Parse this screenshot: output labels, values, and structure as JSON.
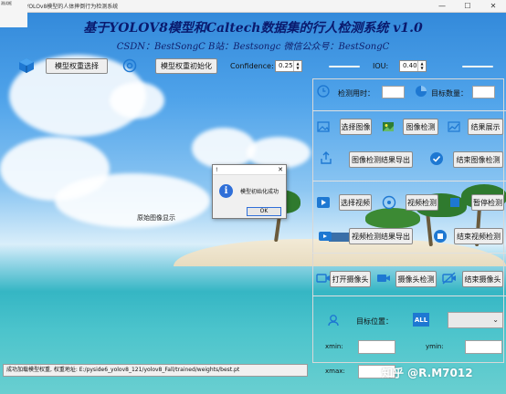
{
  "window": {
    "title": "基于YOLOv8模型的人体摔倒行为检测系统",
    "min_glyph": "—",
    "max_glyph": "☐",
    "close_glyph": "✕",
    "corner_note": "测试框"
  },
  "header": {
    "title": "基于YOLOV8模型和Caltech数据集的行人检测系统 v1.0",
    "subtitle": "CSDN：BestSongC   B站：Bestsongc   微信公众号：BestSongC"
  },
  "toolbar": {
    "select_weights_label": "模型权重选择",
    "init_weights_label": "模型权重初始化",
    "confidence_label": "Confidence:",
    "confidence_value": "0.25",
    "iou_label": "IOU:",
    "iou_value": "0.40"
  },
  "stats": {
    "time_label": "检测用时：",
    "time_value": "",
    "count_label": "目标数量：",
    "count_value": ""
  },
  "image_section": {
    "select_image": "选择图像",
    "image_detect": "图像检测",
    "result_show": "结果展示",
    "export_image_result": "图像检测结果导出",
    "end_image_detect": "结束图像检测"
  },
  "video_section": {
    "select_video": "选择视频",
    "video_detect": "视频检测",
    "pause_detect": "暂停检测",
    "export_video_result": "视频检测结果导出",
    "end_video_detect": "结束视频检测"
  },
  "camera_section": {
    "open_camera": "打开摄像头",
    "camera_detect": "摄像头检测",
    "end_camera": "结束摄像头"
  },
  "target": {
    "position_label": "目标位置：",
    "all_badge": "ALL",
    "select_value": "",
    "xmin_label": "xmin:",
    "ymin_label": "ymin:",
    "xmax_label": "xmax:"
  },
  "display": {
    "placeholder": "原始图像显示"
  },
  "status": {
    "message": "成功加载模型权重, 权重地址: E:/pyside6_yolov8_121/yolov8_Fall/trained/weights/best.pt"
  },
  "dialog": {
    "title": "!",
    "message": "模型初始化成功",
    "ok_label": "OK",
    "close_glyph": "✕"
  },
  "watermark": "知乎 @R.M7012",
  "colors": {
    "title_text": "#0a1a6e",
    "info_blue": "#2f6fd8",
    "button_bg": "#eeeeee"
  }
}
